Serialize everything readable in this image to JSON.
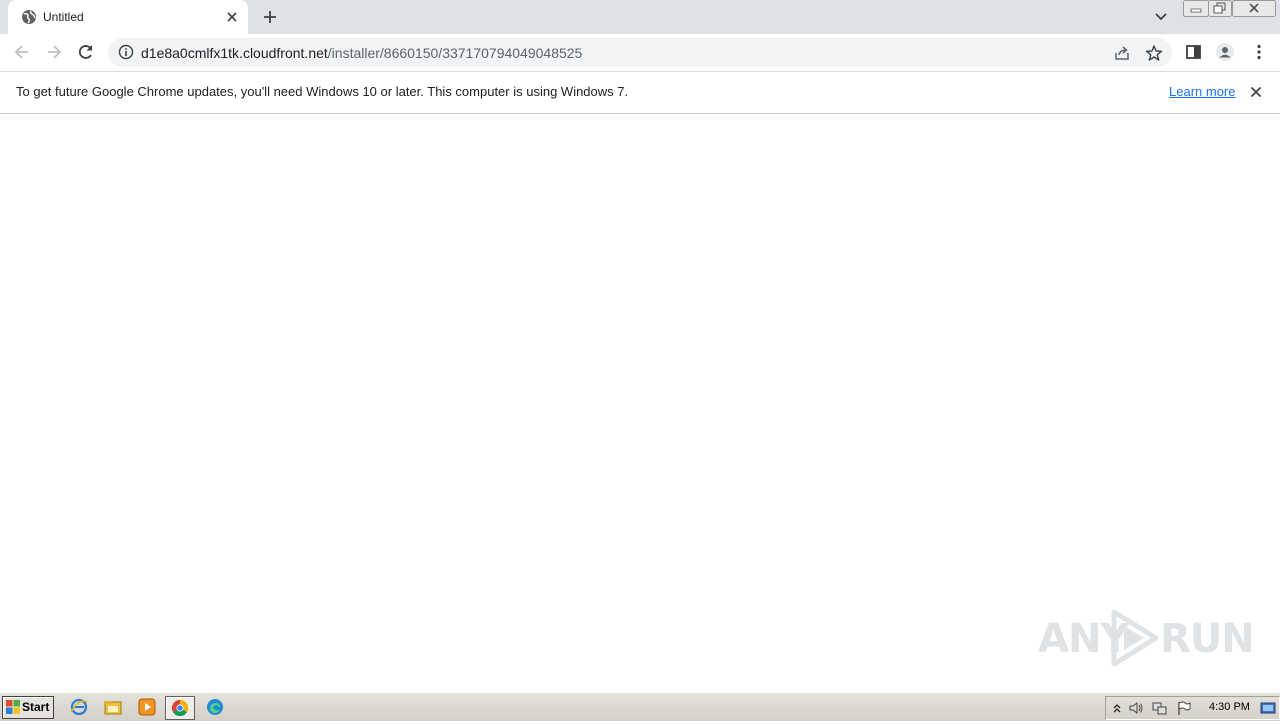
{
  "browser": {
    "tab": {
      "title": "Untitled",
      "icon": "globe-icon"
    },
    "url": {
      "host": "d1e8a0cmlfx1tk.cloudfront.net",
      "path": "/installer/8660150/337170794049048525"
    }
  },
  "infobar": {
    "message": "To get future Google Chrome updates, you'll need Windows 10 or later. This computer is using Windows 7.",
    "link": "Learn more"
  },
  "watermark": {
    "left": "ANY",
    "right": "RUN"
  },
  "taskbar": {
    "start_label": "Start",
    "pinned": [
      "internet-explorer-icon",
      "file-explorer-icon",
      "media-player-icon",
      "chrome-icon",
      "edge-icon"
    ],
    "clock": "4:30 PM"
  },
  "colors": {
    "tabstrip": "#dee1e6",
    "omnibox": "#f1f3f4",
    "link": "#1a73e8",
    "taskbar": "#d4d0c8"
  }
}
